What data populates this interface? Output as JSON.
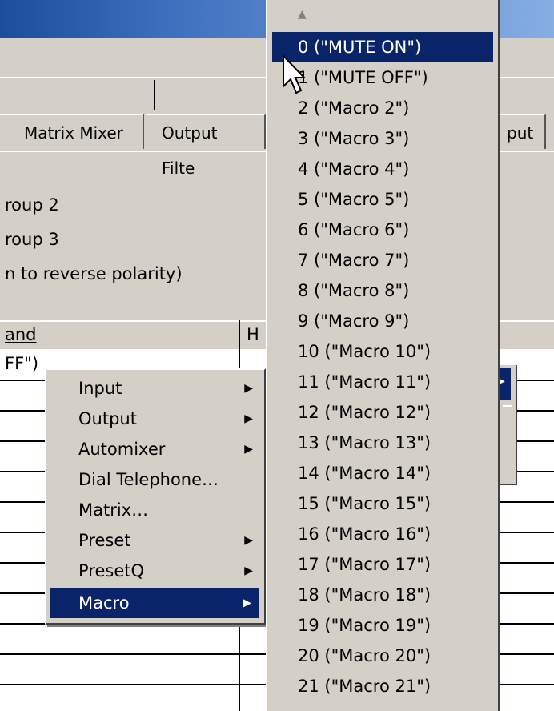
{
  "tabs": [
    {
      "label": "Matrix Mixer"
    },
    {
      "label": "Output Filte"
    },
    {
      "label": "put"
    }
  ],
  "labels": [
    "roup 2",
    "roup 3",
    "n to reverse polarity)"
  ],
  "grid": {
    "col_command": "and",
    "col_h": "H",
    "cell0": "FF\")"
  },
  "context_menu": [
    {
      "label": "Input",
      "has_submenu": true
    },
    {
      "label": "Output",
      "has_submenu": true
    },
    {
      "label": "Automixer",
      "has_submenu": true
    },
    {
      "label": "Dial Telephone…",
      "has_submenu": false
    },
    {
      "label": "Matrix…",
      "has_submenu": false
    },
    {
      "label": "Preset",
      "has_submenu": true
    },
    {
      "label": "PresetQ",
      "has_submenu": true
    },
    {
      "label": "Macro",
      "has_submenu": true,
      "active": true
    }
  ],
  "dropdown": {
    "selected_index": 0,
    "items": [
      "0 (\"MUTE ON\")",
      "1 (\"MUTE OFF\")",
      "2 (\"Macro 2\")",
      "3 (\"Macro 3\")",
      "4 (\"Macro 4\")",
      "5 (\"Macro 5\")",
      "6 (\"Macro 6\")",
      "7 (\"Macro 7\")",
      "8 (\"Macro 8\")",
      "9 (\"Macro 9\")",
      "10 (\"Macro 10\")",
      "11 (\"Macro 11\")",
      "12 (\"Macro 12\")",
      "13 (\"Macro 13\")",
      "14 (\"Macro 14\")",
      "15 (\"Macro 15\")",
      "16 (\"Macro 16\")",
      "17 (\"Macro 17\")",
      "18 (\"Macro 18\")",
      "19 (\"Macro 19\")",
      "20 (\"Macro 20\")",
      "21 (\"Macro 21\")"
    ]
  },
  "icons": {
    "submenu_arrow": "▶",
    "scroll_up": "▲"
  },
  "colors": {
    "highlight": "#0a246a",
    "face": "#d4d0c8"
  }
}
